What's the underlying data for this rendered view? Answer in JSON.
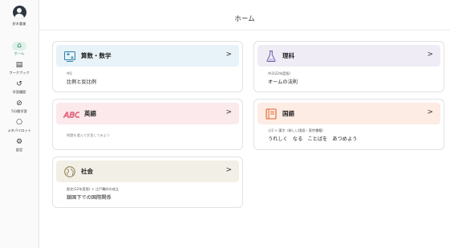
{
  "user": {
    "name": "鈴木重美"
  },
  "nav": [
    {
      "icon": "home-icon",
      "glyph": "⌂",
      "label": "ホーム",
      "active": true
    },
    {
      "icon": "workbook-icon",
      "glyph": "▤",
      "label": "ワークブック",
      "active": false
    },
    {
      "icon": "history-icon",
      "glyph": "↺",
      "label": "学習履歴",
      "active": false
    },
    {
      "icon": "check-icon",
      "glyph": "⊘",
      "label": "5分間学習",
      "active": false
    },
    {
      "icon": "meta-pilot-icon",
      "glyph": "⎔",
      "label": "メタパイロット",
      "active": false
    },
    {
      "icon": "gear-icon",
      "glyph": "⚙",
      "label": "設定",
      "active": false
    }
  ],
  "page": {
    "title": "ホーム"
  },
  "cards": {
    "math": {
      "name": "算数・数学",
      "sub1": "中1",
      "sub2": "比例と反比例",
      "chevron": ">",
      "head_color": "#e7f3f8",
      "icon_color": "#2f7fa8"
    },
    "science": {
      "name": "理科",
      "sub1": "中2(22年度版)",
      "sub2": "オームの法則",
      "chevron": ">",
      "head_color": "#f0ecf6",
      "icon_color": "#6b5aa6"
    },
    "english": {
      "name": "英語",
      "note": "問題を選んで学習してみよう",
      "chevron": ">",
      "head_color": "#fbe9ec",
      "icon_color": "#d8334f"
    },
    "japanese": {
      "name": "国語",
      "sub1": "小2 > 漢字（新しい国語・東京書籍）",
      "sub2": "うれしく　なる　ことばを　あつめよう",
      "chevron": ">",
      "head_color": "#fdece4",
      "icon_color": "#e2632f"
    },
    "social": {
      "name": "社会",
      "sub1": "歴史(22年度版) > 江戸幕府の成立",
      "sub2": "鎖国下での国際関係",
      "chevron": ">",
      "head_color": "#f2efe6",
      "icon_color": "#8a7a4c"
    }
  }
}
